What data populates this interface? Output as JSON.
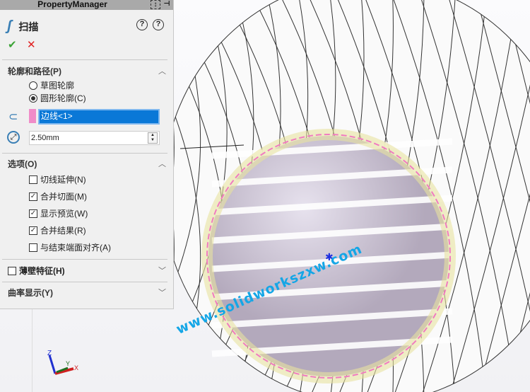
{
  "panel": {
    "title": "PropertyManager",
    "feature": "扫描",
    "ok": "✔",
    "cancel": "✕",
    "section_profile": {
      "label": "轮廓和路径(P)",
      "options": [
        {
          "label": "草图轮廓",
          "selected": false
        },
        {
          "label": "圆形轮廓(C)",
          "selected": true
        }
      ],
      "path_value": "边线<1>",
      "diameter": "2.50mm"
    },
    "section_options": {
      "label": "选项(O)",
      "items": [
        {
          "label": "切线延伸(N)",
          "checked": false
        },
        {
          "label": "合并切面(M)",
          "checked": true
        },
        {
          "label": "显示预览(W)",
          "checked": true
        },
        {
          "label": "合并结果(R)",
          "checked": true
        },
        {
          "label": "与结束端面对齐(A)",
          "checked": false
        }
      ]
    },
    "section_thin": {
      "label": "薄壁特征(H)",
      "checked": false
    },
    "section_curvature": {
      "label": "曲率显示(Y)"
    }
  },
  "watermark": "www.solidworkszxw.com",
  "triad": {
    "x": "X",
    "y": "Y",
    "z": "Z"
  },
  "colors": {
    "accent": "#0a78d7",
    "path": "#f08cc8",
    "watermark": "#14a6e6"
  }
}
